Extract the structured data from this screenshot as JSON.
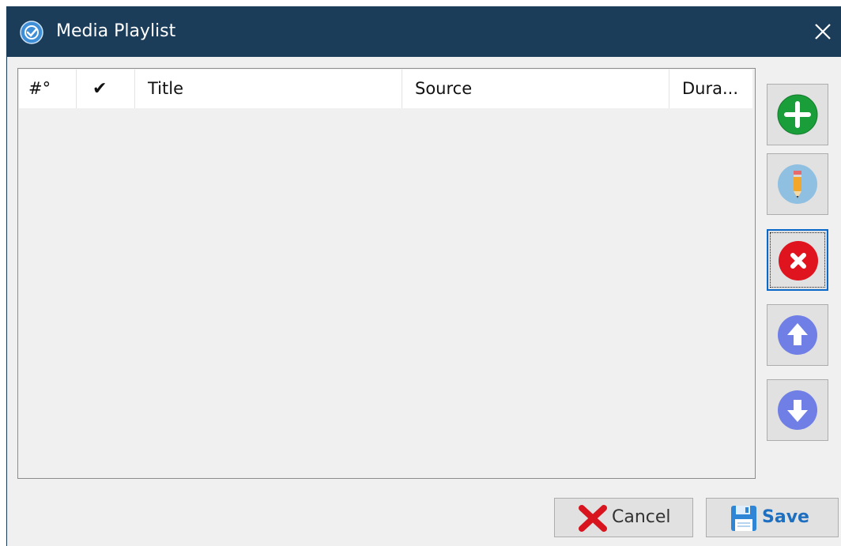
{
  "window": {
    "title": "Media Playlist",
    "close_glyph": "✕"
  },
  "playlist": {
    "columns": [
      "#°",
      "✔",
      "Title",
      "Source",
      "Dura..."
    ],
    "rows": []
  },
  "side_buttons": [
    {
      "name": "add",
      "icon": "plus-circle-icon",
      "color": "#1a9e3a"
    },
    {
      "name": "edit",
      "icon": "pencil-icon",
      "color": "#7fb6dc"
    },
    {
      "name": "remove",
      "icon": "x-circle-icon",
      "color": "#e0141e"
    },
    {
      "name": "move-up",
      "icon": "arrow-up-circle-icon",
      "color": "#6f7fe6"
    },
    {
      "name": "move-down",
      "icon": "arrow-down-circle-icon",
      "color": "#6f7fe6"
    }
  ],
  "footer": {
    "cancel_label": "Cancel",
    "save_label": "Save"
  },
  "colors": {
    "titlebar": "#1c3d5a",
    "window_bg": "#f0f0f0",
    "focus_border": "#0a68c8"
  }
}
